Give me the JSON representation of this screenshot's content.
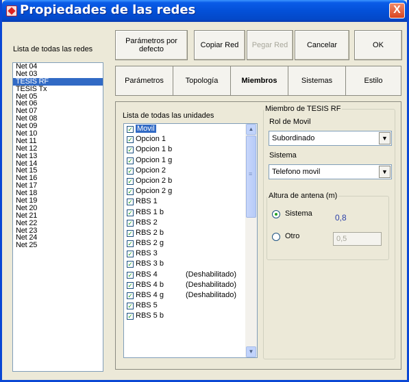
{
  "window": {
    "title": "Propiedades de las redes",
    "close_glyph": "X"
  },
  "toolbar": {
    "params_default": "Parámetros por defecto",
    "copy": "Copiar Red",
    "paste": "Pegar Red",
    "cancel": "Cancelar",
    "ok": "OK"
  },
  "networks": {
    "label": "Lista de todas las redes",
    "items": [
      "Net 04",
      "Net 03",
      "TESIS RF",
      "TESIS Tx",
      "Net 05",
      "Net 06",
      "Net 07",
      "Net 08",
      "Net 09",
      "Net 10",
      "Net 11",
      "Net 12",
      "Net 13",
      "Net 14",
      "Net 15",
      "Net 16",
      "Net 17",
      "Net 18",
      "Net 19",
      "Net 20",
      "Net 21",
      "Net 22",
      "Net 23",
      "Net 24",
      "Net 25"
    ],
    "selected": "TESIS RF"
  },
  "tabs": [
    {
      "label": "Parámetros"
    },
    {
      "label": "Topología"
    },
    {
      "label": "Miembros",
      "active": true
    },
    {
      "label": "Sistemas"
    },
    {
      "label": "Estilo"
    }
  ],
  "units": {
    "label": "Lista de todas las unidades",
    "items": [
      {
        "name": "Movil",
        "checked": true,
        "selected": true
      },
      {
        "name": "Opcion 1",
        "checked": true
      },
      {
        "name": "Opcion 1 b",
        "checked": true
      },
      {
        "name": "Opcion 1 g",
        "checked": true
      },
      {
        "name": "Opcion 2",
        "checked": true
      },
      {
        "name": "Opcion 2 b",
        "checked": true
      },
      {
        "name": "Opcion 2 g",
        "checked": true
      },
      {
        "name": "RBS 1",
        "checked": true
      },
      {
        "name": "RBS 1 b",
        "checked": true
      },
      {
        "name": "RBS 2",
        "checked": true
      },
      {
        "name": "RBS 2 b",
        "checked": true
      },
      {
        "name": "RBS 2 g",
        "checked": true
      },
      {
        "name": "RBS 3",
        "checked": true
      },
      {
        "name": "RBS 3 b",
        "checked": true
      },
      {
        "name": "RBS 4",
        "checked": true,
        "status": "(Deshabilitado)"
      },
      {
        "name": "RBS 4 b",
        "checked": true,
        "status": "(Deshabilitado)"
      },
      {
        "name": "RBS 4 g",
        "checked": true,
        "status": "(Deshabilitado)"
      },
      {
        "name": "RBS 5",
        "checked": true
      },
      {
        "name": "RBS 5 b",
        "checked": true
      }
    ],
    "scroll_up": "▲",
    "scroll_down": "▼"
  },
  "member": {
    "group_title": "Miembro de TESIS RF",
    "role_label": "Rol de Movil",
    "role_value": "Subordinado",
    "system_label": "Sistema",
    "system_value": "Telefono movil",
    "antenna_title": "Altura de antena (m)",
    "option_system": "Sistema",
    "system_height": "0,8",
    "option_other": "Otro",
    "other_height": "0,5",
    "dropdown_glyph": "▼"
  },
  "colors": {
    "selection": "#316ac5",
    "titlebar": "#0350d8",
    "value_blue": "#2a3fa8"
  }
}
